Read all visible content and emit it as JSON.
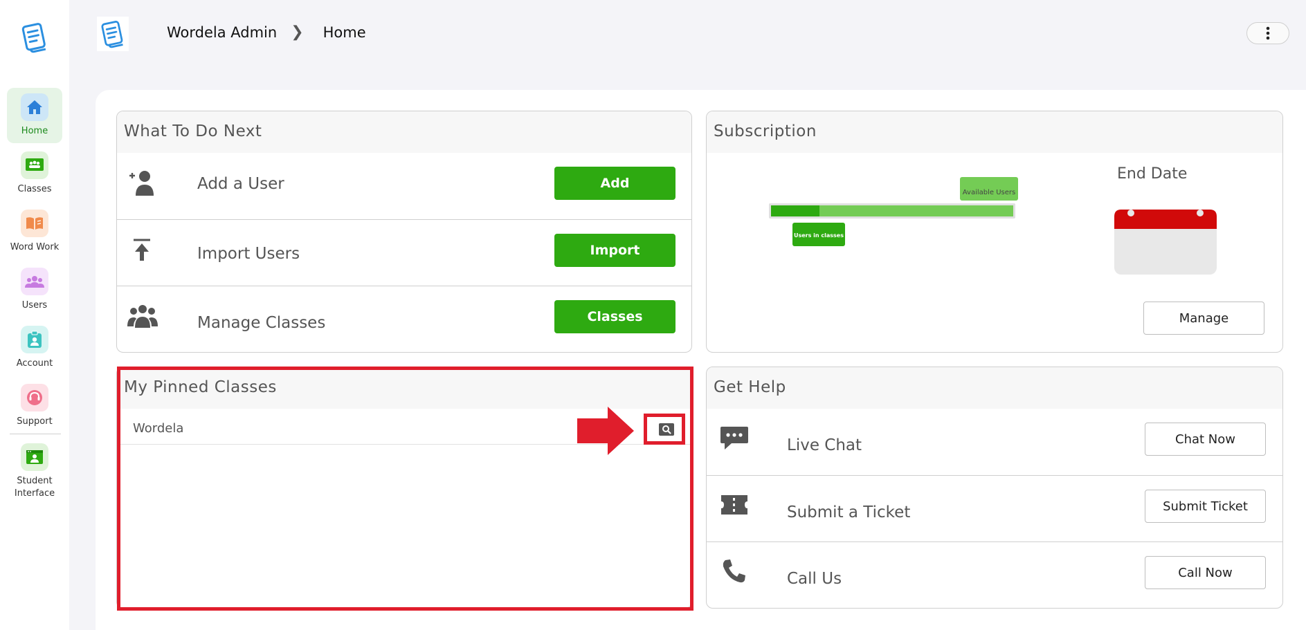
{
  "sidebar": {
    "items": [
      {
        "label": "Home",
        "icon": "house-icon",
        "color": "#2b7fd8"
      },
      {
        "label": "Classes",
        "icon": "classroom-icon",
        "color": "#2eaa11"
      },
      {
        "label": "Word Work",
        "icon": "book-icon",
        "color": "#f08a4b"
      },
      {
        "label": "Users",
        "icon": "users-icon",
        "color": "#c77be0"
      },
      {
        "label": "Account",
        "icon": "id-badge-icon",
        "color": "#3cc3c0"
      },
      {
        "label": "Support",
        "icon": "headset-icon",
        "color": "#ef6f8a"
      },
      {
        "label": "Student Interface",
        "icon": "student-screen-icon",
        "color": "#2eaa11"
      }
    ]
  },
  "header": {
    "breadcrumb": [
      "Wordela Admin",
      "Home"
    ]
  },
  "todo": {
    "title": "What To Do Next",
    "rows": [
      {
        "label": "Add a User",
        "button": "Add",
        "icon": "add-user-icon"
      },
      {
        "label": "Import Users",
        "button": "Import",
        "icon": "upload-icon"
      },
      {
        "label": "Manage Classes",
        "button": "Classes",
        "icon": "group-icon"
      }
    ]
  },
  "subscription": {
    "title": "Subscription",
    "users_in_classes_label": "Users in classes",
    "available_users_label": "Available Users",
    "users_in_classes_fraction": 0.2,
    "end_date_label": "End Date",
    "manage_button": "Manage"
  },
  "pinned": {
    "title": "My Pinned Classes",
    "classes": [
      {
        "name": "Wordela"
      }
    ]
  },
  "help": {
    "title": "Get Help",
    "rows": [
      {
        "label": "Live Chat",
        "button": "Chat Now",
        "icon": "chat-icon"
      },
      {
        "label": "Submit a Ticket",
        "button": "Submit Ticket",
        "icon": "ticket-icon"
      },
      {
        "label": "Call Us",
        "button": "Call Now",
        "icon": "phone-icon"
      }
    ]
  },
  "colors": {
    "accent_green": "#2eaa11",
    "light_green": "#74cc55",
    "annotation_red": "#e01e2c",
    "calendar_red": "#d10a0a"
  }
}
